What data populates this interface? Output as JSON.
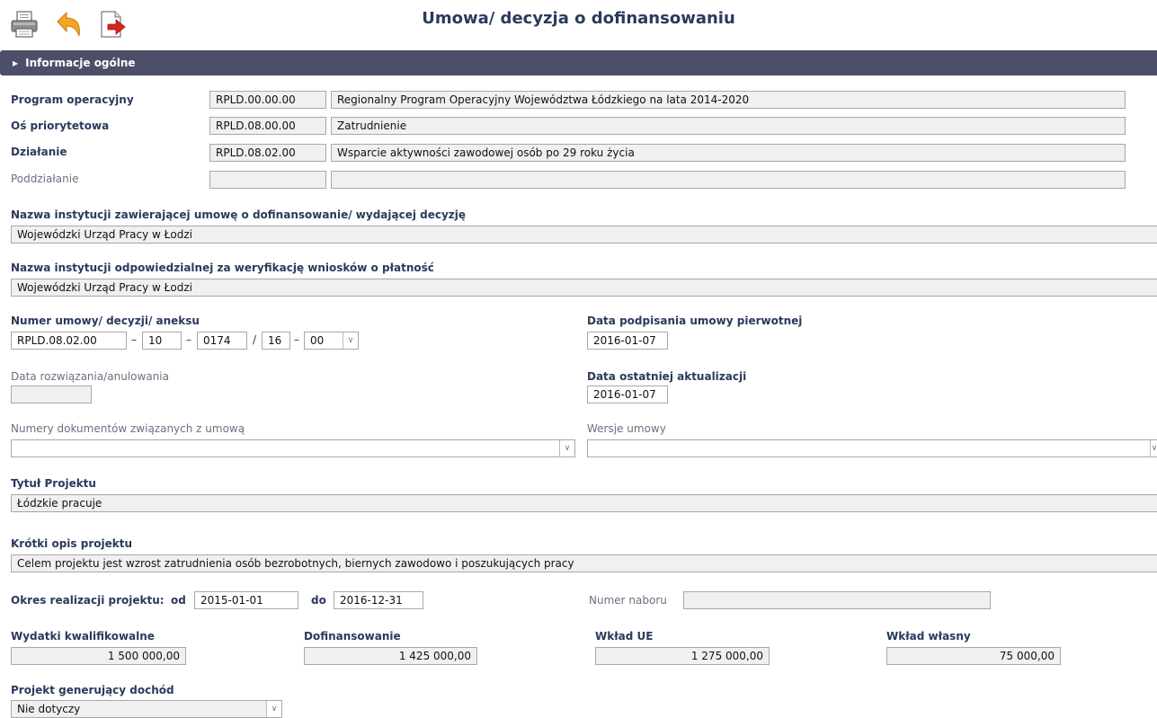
{
  "header": {
    "title": "Umowa/ decyzja o dofinansowaniu"
  },
  "toolbar": {
    "icons": [
      "printer-icon",
      "undo-icon",
      "export-icon"
    ]
  },
  "section": {
    "title": "Informacje ogólne"
  },
  "program": {
    "label": "Program operacyjny",
    "code": "RPLD.00.00.00",
    "name": "Regionalny Program Operacyjny Województwa Łódzkiego na lata 2014-2020"
  },
  "os": {
    "label": "Oś priorytetowa",
    "code": "RPLD.08.00.00",
    "name": "Zatrudnienie"
  },
  "dzialanie": {
    "label": "Działanie",
    "code": "RPLD.08.02.00",
    "name": "Wsparcie aktywności zawodowej osób po 29 roku życia"
  },
  "poddzialanie": {
    "label": "Poddziałanie",
    "code": "",
    "name": ""
  },
  "instytucja_umowy": {
    "label": "Nazwa instytucji zawierającej umowę o dofinansowanie/ wydającej decyzję",
    "value": "Wojewódzki Urząd Pracy w Łodzi"
  },
  "instytucja_weryfikacji": {
    "label": "Nazwa instytucji odpowiedzialnej za weryfikację wniosków o płatność",
    "value": "Wojewódzki Urząd Pracy w Łodzi"
  },
  "numer_umowy": {
    "label": "Numer umowy/ decyzji/ aneksu",
    "part1": "RPLD.08.02.00",
    "part2": "10",
    "part3": "0174",
    "part4": "16",
    "part5": "00",
    "sep_dash": "–",
    "sep_slash": "/"
  },
  "data_podpisania": {
    "label": "Data podpisania umowy pierwotnej",
    "value": "2016-01-07"
  },
  "data_rozwiazania": {
    "label": "Data rozwiązania/anulowania",
    "value": ""
  },
  "data_aktualizacji": {
    "label": "Data ostatniej aktualizacji",
    "value": "2016-01-07"
  },
  "numery_dokumentow": {
    "label": "Numery dokumentów związanych z umową",
    "value": ""
  },
  "wersje_umowy": {
    "label": "Wersje umowy",
    "value": ""
  },
  "tytul": {
    "label": "Tytuł Projektu",
    "value": "Łódzkie pracuje"
  },
  "opis": {
    "label": "Krótki opis projektu",
    "value": "Celem projektu jest wzrost zatrudnienia osób bezrobotnych, biernych zawodowo i poszukujących pracy"
  },
  "okres": {
    "label": "Okres realizacji projektu:",
    "od_label": "od",
    "od": "2015-01-01",
    "do_label": "do",
    "do": "2016-12-31"
  },
  "numer_naboru": {
    "label": "Numer naboru",
    "value": ""
  },
  "wydatki": {
    "label": "Wydatki kwalifikowalne",
    "value": "1 500 000,00"
  },
  "dofinansowanie": {
    "label": "Dofinansowanie",
    "value": "1 425 000,00"
  },
  "wklad_ue": {
    "label": "Wkład UE",
    "value": "1 275 000,00"
  },
  "wklad_wlasny": {
    "label": "Wkład własny",
    "value": "75 000,00"
  },
  "dochod": {
    "label": "Projekt generujący dochód",
    "value": "Nie dotyczy"
  }
}
